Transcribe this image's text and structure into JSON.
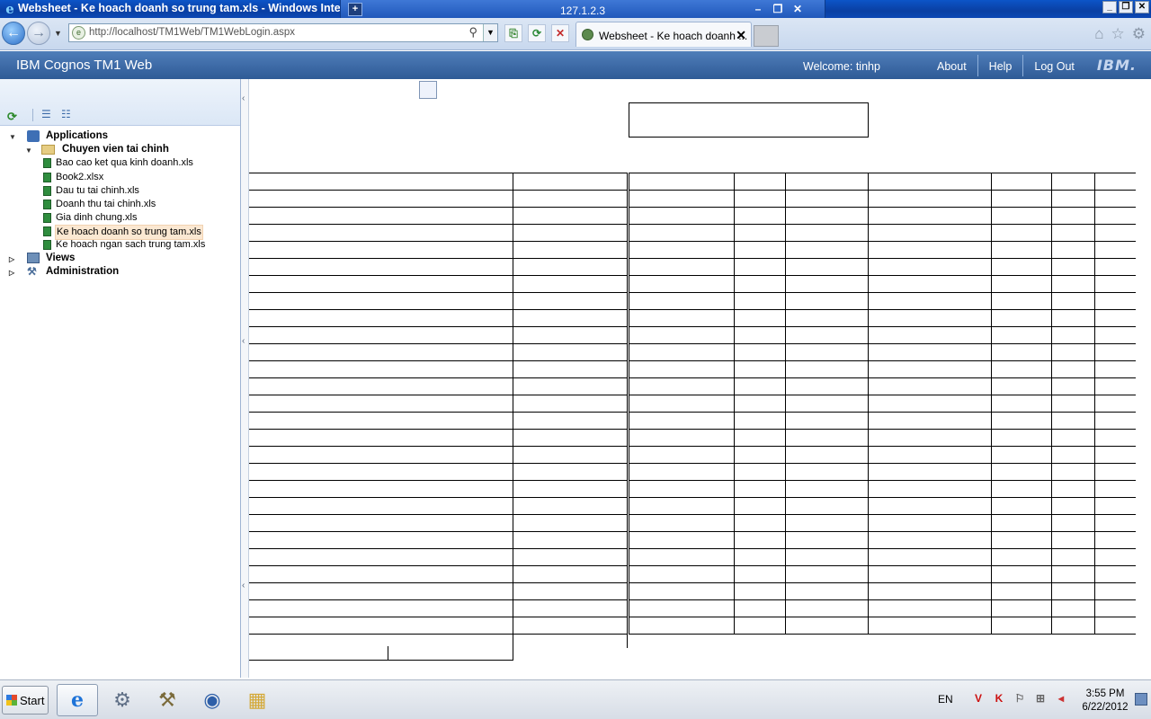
{
  "window": {
    "title": "Websheet - Ke hoach doanh so trung tam.xls - Windows Internet Explorer",
    "remote_host": "127.1.2.3"
  },
  "browser": {
    "url": "http://localhost/TM1Web/TM1WebLogin.aspx",
    "tab_label": "Websheet - Ke hoach doanh ...",
    "icons": [
      "back-icon",
      "forward-icon",
      "search-icon",
      "compat-view-icon",
      "refresh-icon",
      "stop-icon",
      "home-icon",
      "favorites-icon",
      "tools-icon"
    ]
  },
  "app": {
    "title": "IBM Cognos TM1 Web",
    "welcome": "Welcome: tinhp",
    "about": "About",
    "help": "Help",
    "logout": "Log Out",
    "logo": "IBM."
  },
  "tree": {
    "applications": "Applications",
    "folder": "Chuyen vien tai chinh",
    "files": [
      "Bao cao ket qua kinh doanh.xls",
      "Book2.xlsx",
      "Dau tu tai chinh.xls",
      "Doanh thu tai chinh.xls",
      "Gia dinh chung.xls",
      "Ke hoach doanh so trung tam.xls",
      "Ke hoach ngan sach trung tam.xls"
    ],
    "selected_index": 5,
    "views": "Views",
    "administration": "Administration"
  },
  "taskbar": {
    "start": "Start",
    "language": "EN",
    "time": "3:55 PM",
    "date": "6/22/2012"
  }
}
